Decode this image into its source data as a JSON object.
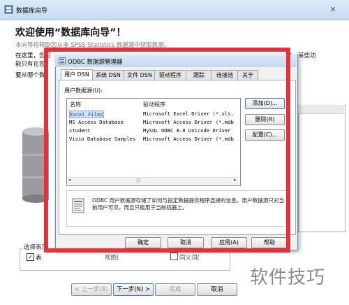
{
  "wizard": {
    "title": "数据库向导",
    "close_glyph": "✕",
    "heading": "欢迎使用“数据库向导”！",
    "line1": "本向导将帮助您从非 SPSS Statistics 数据源中获取数据。",
    "line2": "在这里，您可",
    "line2_right": "性，某些功",
    "line3": "能只有在您",
    "line4": "要从哪个数",
    "select_group_label": "选择表示",
    "checkbox_mark": "✓",
    "checkbox_label": "表",
    "option2_label": "视图(",
    "option3_label": "同义词(",
    "buttons": {
      "prev": "< 上一步(B)",
      "next": "下一步(N) >",
      "finish": "完成",
      "cancel": "取消"
    }
  },
  "odbc": {
    "title": "ODBC 数据源管理器",
    "tabs": [
      "用户 DSN",
      "系统 DSN",
      "文件 DSN",
      "驱动程序",
      "跟踪",
      "连接池",
      "关于"
    ],
    "active_tab": 0,
    "list_label": "用户数据源(U):",
    "columns": [
      "名称",
      "驱动程序"
    ],
    "rows": [
      {
        "name": "Excel Files",
        "driver": "Microsoft Excel Driver (*.xls,"
      },
      {
        "name": "MS Access Database",
        "driver": "Microsoft Access Driver (*.mdb"
      },
      {
        "name": "student",
        "driver": "MySQL ODBC 8.0 Unicode Driver"
      },
      {
        "name": "Visio Database Samples",
        "driver": "Microsoft Access Driver (*.mdb"
      }
    ],
    "selected_row": 0,
    "scroll_left": "◂",
    "scroll_right": "▸",
    "scroll_thumb": "|||",
    "side_buttons": {
      "add": "添加(D)...",
      "remove": "删除(R)",
      "configure": "配置(C)..."
    },
    "info_text": "ODBC 用户数据源存储了如何与指定数据提供程序连接的信息。用户数据源只对当前用户可见，而且只能用于当前机器上。",
    "buttons": {
      "ok": "确定",
      "cancel": "取消",
      "apply": "应用(A)",
      "help": "帮助"
    }
  },
  "watermark": "软件技巧",
  "colors": {
    "highlight": "#e5313a",
    "selection": "#cce0f5",
    "title_bar": "#c6dcf2"
  }
}
